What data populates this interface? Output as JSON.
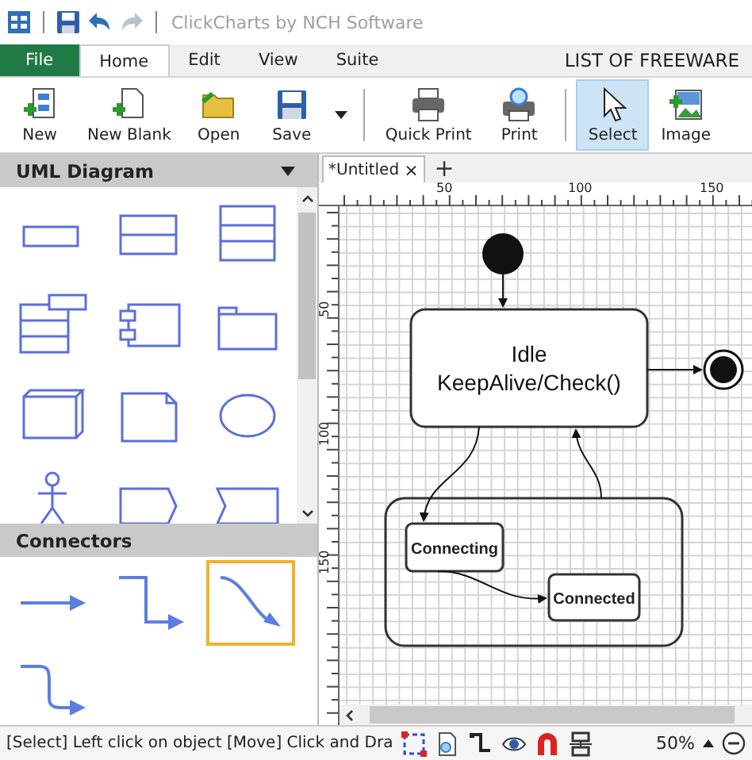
{
  "title_bar": {
    "title": "ClickCharts by NCH Software"
  },
  "ribbon_tabs": [
    {
      "label": "File",
      "kind": "file",
      "selected": false
    },
    {
      "label": "Home",
      "kind": "tab",
      "selected": true
    },
    {
      "label": "Edit",
      "kind": "tab",
      "selected": false
    },
    {
      "label": "View",
      "kind": "tab",
      "selected": false
    },
    {
      "label": "Suite",
      "kind": "tab",
      "selected": false
    }
  ],
  "ribbon_caption": "LIST OF FREEWARE",
  "toolbar": [
    {
      "label": "New",
      "kind": "new",
      "selected": false
    },
    {
      "label": "New Blank",
      "kind": "blank",
      "selected": false
    },
    {
      "label": "Open",
      "kind": "open",
      "selected": false
    },
    {
      "label": "Save",
      "kind": "save",
      "selected": false
    },
    {
      "label": "Quick Print",
      "kind": "quickprint",
      "selected": false
    },
    {
      "label": "Print",
      "kind": "print",
      "selected": false
    },
    {
      "label": "Select",
      "kind": "select",
      "selected": true
    },
    {
      "label": "Image",
      "kind": "image",
      "selected": false
    }
  ],
  "library": {
    "title": "UML Diagram",
    "shapes": [
      {
        "kind": "class"
      },
      {
        "kind": "class2"
      },
      {
        "kind": "class3"
      },
      {
        "kind": "template"
      },
      {
        "kind": "component"
      },
      {
        "kind": "package"
      },
      {
        "kind": "node"
      },
      {
        "kind": "note"
      },
      {
        "kind": "usecase"
      },
      {
        "kind": "actor"
      },
      {
        "kind": "send"
      },
      {
        "kind": "receive"
      }
    ]
  },
  "connectors": {
    "title": "Connectors",
    "items": [
      {
        "kind": "straight",
        "selected": false
      },
      {
        "kind": "elbow",
        "selected": false
      },
      {
        "kind": "curved",
        "selected": true
      },
      {
        "kind": "rounded",
        "selected": false
      }
    ]
  },
  "document_tab": {
    "label": "*Untitled",
    "close": "×",
    "new_tab": "+"
  },
  "ruler": {
    "horizontal": [
      "50",
      "100",
      "150"
    ],
    "vertical": [
      "50",
      "100",
      "150"
    ]
  },
  "diagram": {
    "states": [
      {
        "kind": "simple",
        "lines": [
          "Idle",
          "KeepAlive/Check()"
        ]
      },
      {
        "kind": "composite"
      },
      {
        "kind": "simple",
        "lines": [
          "Connecting"
        ]
      },
      {
        "kind": "simple",
        "lines": [
          "Connected"
        ]
      }
    ]
  },
  "status_bar": {
    "text": "[Select] Left click on object  [Move] Click and Dra",
    "zoom": "50%"
  }
}
